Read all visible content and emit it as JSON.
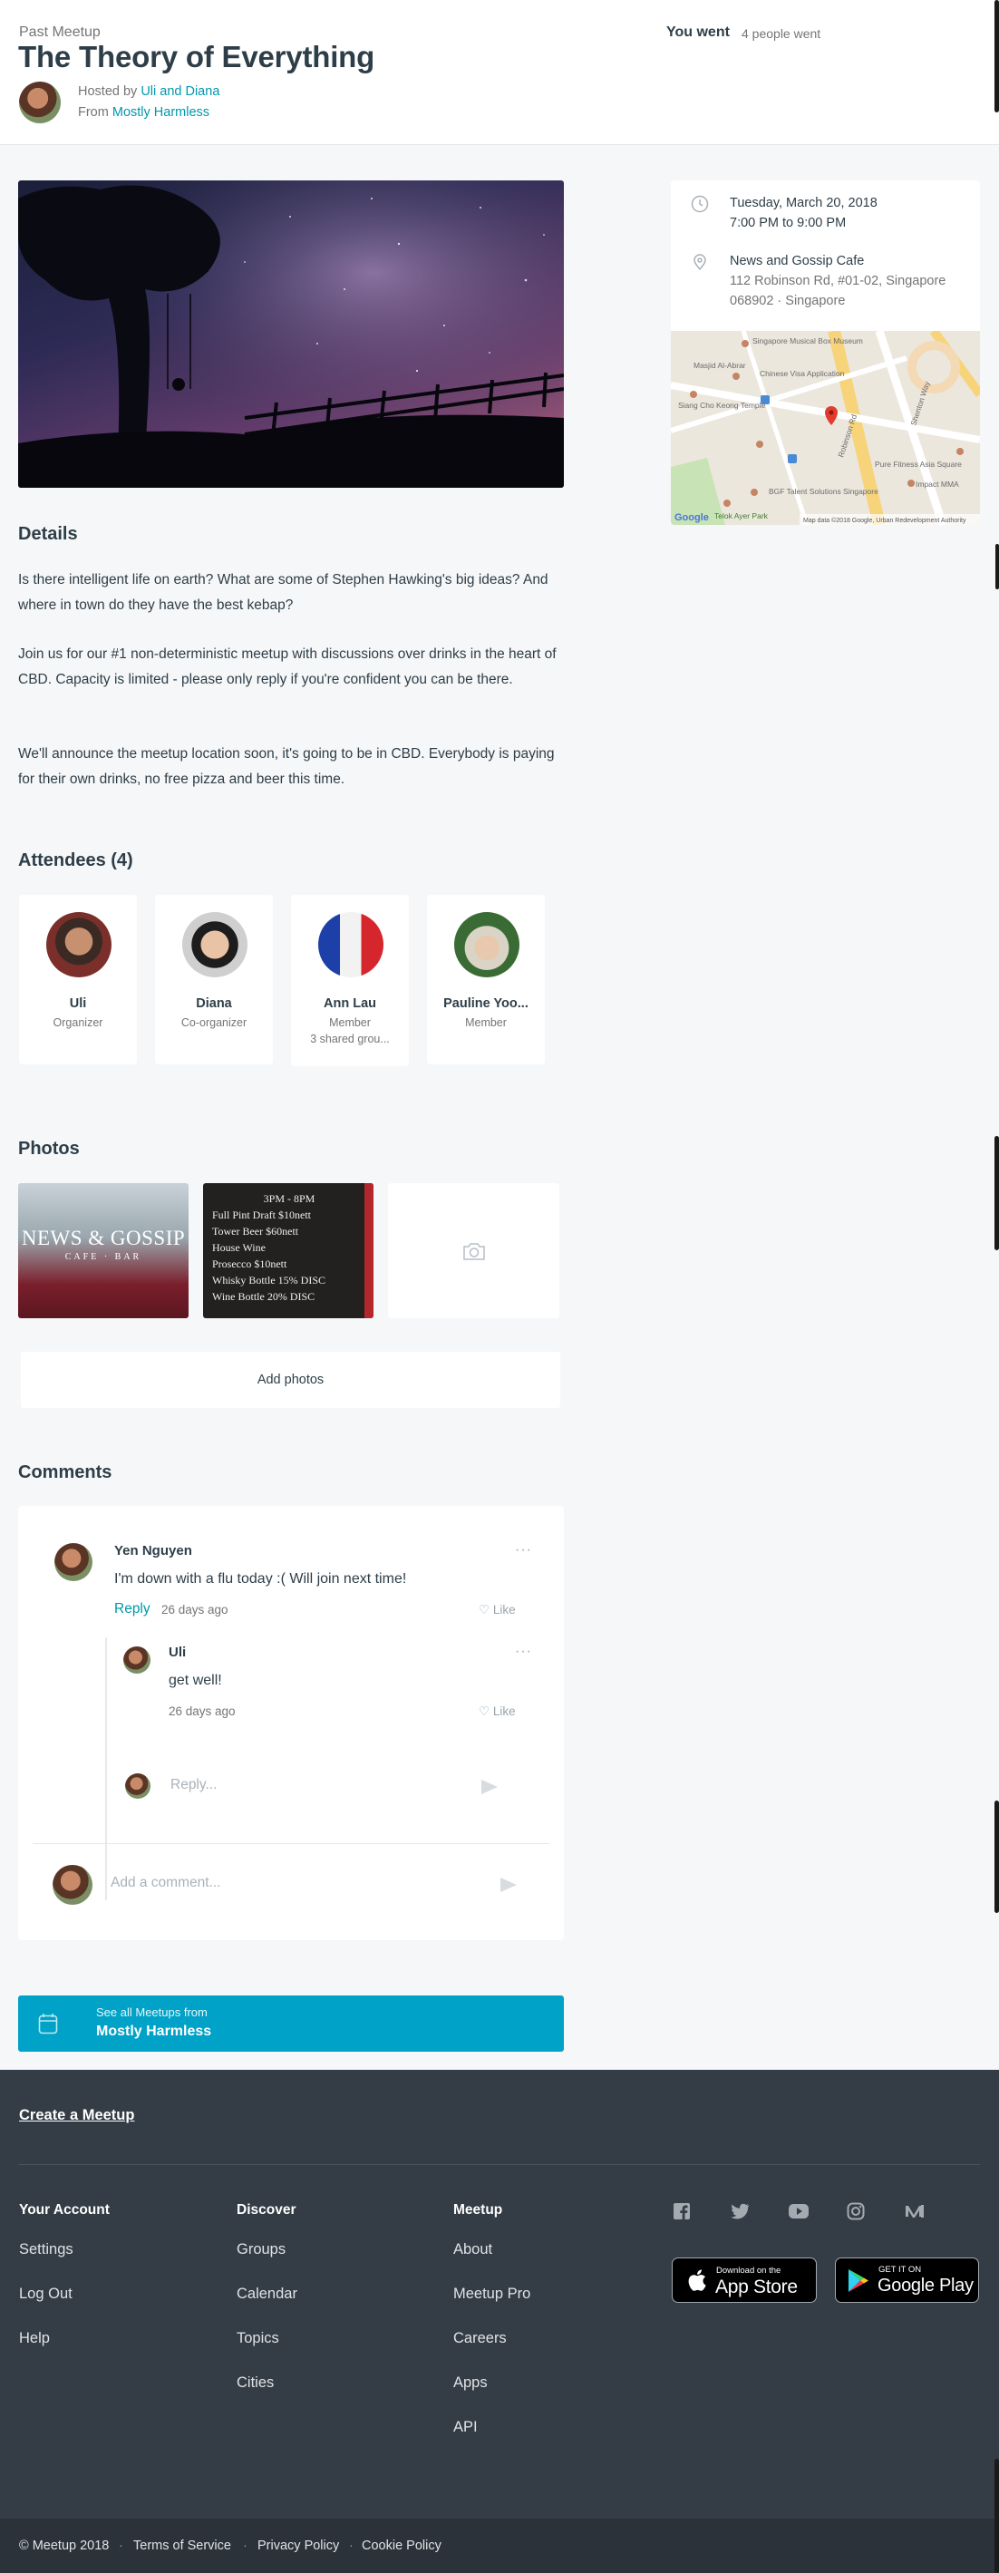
{
  "header": {
    "kicker": "Past Meetup",
    "title": "The Theory of Everything",
    "hosted_prefix": "Hosted by",
    "hosts": "Uli and Diana",
    "from_prefix": "From",
    "group": "Mostly Harmless",
    "rsvp_status": "You went",
    "attendance": "4 people went"
  },
  "event": {
    "date": "Tuesday, March 20, 2018",
    "time": "7:00 PM to 9:00 PM",
    "venue": "News and Gossip Cafe",
    "address_line1": "112 Robinson Rd, #01-02, Singapore",
    "address_line2": "068902 · Singapore",
    "map_labels": {
      "museum": "Singapore Musical Box Museum",
      "visa": "Chinese Visa Application",
      "masjid": "Masjid Al-Abrar",
      "temple": "Siang Cho Keong Temple",
      "robinson": "Robinson Rd",
      "shenton": "Shenton Way",
      "pure": "Pure Fitness Asia Square",
      "impact": "Impact MMA",
      "bgf": "BGF Talent Solutions Singapore",
      "park": "Telok Ayer Park",
      "logo": "Google",
      "copyright": "Map data ©2018 Google, Urban Redevelopment Authority"
    }
  },
  "details": {
    "heading": "Details",
    "paragraphs": [
      "Is there intelligent life on earth? What are some of Stephen Hawking's big ideas? And where in town do they have the best kebap?",
      "Join us for our #1 non-deterministic meetup with discussions over drinks in the heart of CBD. Capacity is limited - please only reply if you're confident you can be there.",
      "We'll announce the meetup location soon, it's going to be in CBD. Everybody is paying for their own drinks, no free pizza and beer this time."
    ]
  },
  "attendees": {
    "heading": "Attendees (4)",
    "items": [
      {
        "name": "Uli",
        "role": "Organizer",
        "extra": ""
      },
      {
        "name": "Diana",
        "role": "Co-organizer",
        "extra": ""
      },
      {
        "name": "Ann Lau",
        "role": "Member",
        "extra": "3 shared grou..."
      },
      {
        "name": "Pauline Yoo...",
        "role": "Member",
        "extra": ""
      }
    ]
  },
  "photos": {
    "heading": "Photos",
    "photo1_text": "NEWS & GOSSIP",
    "photo1_sub": "CAFE · BAR",
    "photo2_lines": [
      "3PM - 8PM",
      "Full Pint Draft   $10nett",
      "Tower Beer   $60nett",
      "House Wine",
      "Prosecco   $10nett",
      "Whisky Bottle   15% DISC",
      "Wine Bottle   20% DISC"
    ],
    "add_label": "Add photos"
  },
  "comments": {
    "heading": "Comments",
    "thread": {
      "author": "Yen Nguyen",
      "text": "I'm down with a flu today :( Will join next time!",
      "reply_label": "Reply",
      "time": "26 days ago",
      "like_label": "Like",
      "more": "···"
    },
    "reply": {
      "author": "Uli",
      "text": "get well!",
      "time": "26 days ago",
      "like_label": "Like",
      "more": "···"
    },
    "reply_placeholder": "Reply...",
    "comment_placeholder": "Add a comment..."
  },
  "see_all": {
    "line1": "See all Meetups from",
    "line2": "Mostly Harmless"
  },
  "footer": {
    "create": "Create a Meetup",
    "columns": [
      {
        "heading": "Your Account",
        "links": [
          "Settings",
          "Log Out",
          "Help"
        ]
      },
      {
        "heading": "Discover",
        "links": [
          "Groups",
          "Calendar",
          "Topics",
          "Cities"
        ]
      },
      {
        "heading": "Meetup",
        "links": [
          "About",
          "Meetup Pro",
          "Careers",
          "Apps",
          "API"
        ]
      }
    ],
    "social_icons": [
      "facebook-icon",
      "twitter-icon",
      "youtube-icon",
      "instagram-icon",
      "medium-icon"
    ],
    "app_store": {
      "small": "Download on the",
      "big": "App Store"
    },
    "google_play": {
      "small": "GET IT ON",
      "big": "Google Play"
    },
    "bottom": [
      "© Meetup 2018",
      "Terms of Service",
      "Privacy Policy",
      "Cookie Policy"
    ]
  },
  "colors": {
    "accent": "#0098ab",
    "button": "#00a2c7",
    "footer": "#343c45"
  }
}
